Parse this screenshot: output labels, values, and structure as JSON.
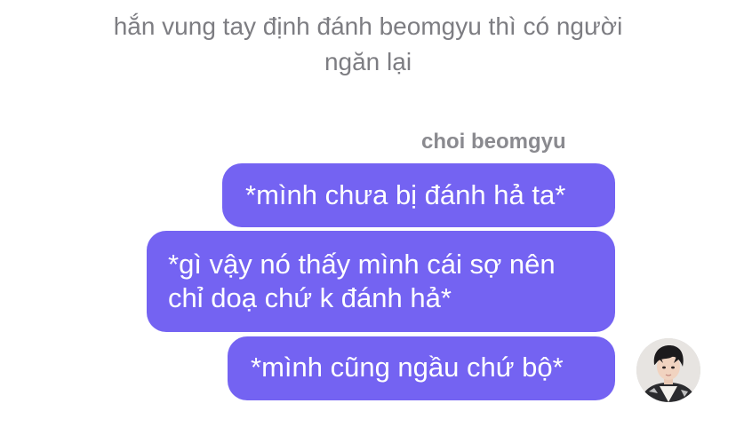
{
  "narration": "hắn vung tay định đánh beomgyu thì có người ngăn lại",
  "chat": {
    "sender_name": "choi beomgyu",
    "messages": [
      {
        "text": "*mình chưa bị đánh hả ta*"
      },
      {
        "lines": [
          "*gì vậy nó thấy mình cái sợ nên",
          "chỉ doạ chứ k đánh hả*"
        ]
      },
      {
        "text": "*mình cũng ngầu chứ bộ*"
      }
    ],
    "bubble_color": "#7463f2",
    "text_color": "#ffffff",
    "avatar_icon": "profile-photo-avatar"
  }
}
